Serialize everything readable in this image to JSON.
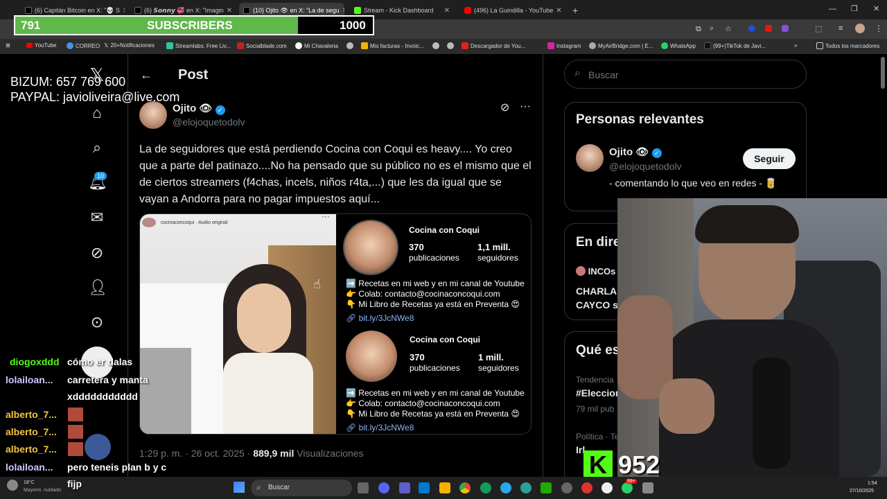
{
  "browser": {
    "tabs": [
      {
        "label": "(6) Capitán Bitcoin en X: \"💀 S",
        "color": "#000"
      },
      {
        "label": "(6) 𝙎𝙤𝙣𝙣𝙮 💞 en X: \"Imagin",
        "color": "#000"
      },
      {
        "label": "(10) Ojito 👁 en X: \"La de segu",
        "color": "#000",
        "active": true
      },
      {
        "label": "Stream - Kick Dashboard",
        "color": "#53fc18"
      },
      {
        "label": "(496) La Guindilla - YouTube",
        "color": "#ff0000"
      }
    ],
    "new_tab": "+",
    "bookmarks": [
      "YouTube",
      "CORREO",
      "20+Notificaciones",
      "Streamlabs: Free Liv...",
      "Socialblade.com",
      "Mi Chavaleria",
      "",
      "Mis facturas - Invoic...",
      "",
      "",
      "Descargador de You...",
      "Instagram",
      "MyAirBridge.com | E...",
      "WhatsApp",
      "(99+)TikTok de Javi..."
    ],
    "bookmarks_folder": "Todos los marcadores"
  },
  "overlay": {
    "subs_current": "791",
    "subs_label": "SUBSCRIBERS",
    "subs_goal": "1000",
    "subs_progress": 0.791,
    "bizum": "BIZUM: 657 769 600",
    "paypal": "PAYPAL: javioliveira@live.com",
    "kick_count": "952"
  },
  "sidebar": {
    "notifications_badge": "10"
  },
  "post": {
    "header": "Post",
    "author_name": "Ojito",
    "author_emoji": "👁",
    "author_handle": "@elojoquetodolv",
    "text": "La de seguidores que está perdiendo Cocina con Coqui es heavy.... Yo creo que a parte del patinazo....No ha pensado que su público no es el mismo que el de ciertos streamers (f4chas, incels, niños r4ta,...) que les da igual que se vayan a Andorra para no pagar impuestos aquí...",
    "video_user": "cocinaconcoqui · Audio original",
    "profile1": {
      "name": "Cocina con Coqui",
      "posts": "370",
      "posts_label": "publicaciones",
      "followers": "1,1 mill.",
      "followers_label": "seguidores"
    },
    "profile2": {
      "name": "Cocina con Coqui",
      "posts": "370",
      "posts_label": "publicaciones",
      "followers": "1 mill.",
      "followers_label": "seguidores"
    },
    "bio_line1": "➡️ Recetas en mi web y en mi canal de Youtube",
    "bio_line2": "👉 Colab: contacto@cocinaconcoqui.com",
    "bio_line3": "👇 Mi Libro de Recetas ya está en Preventa 😍",
    "bio_link": "bit.ly/3JcNWe8",
    "time": "1:29 p. m.",
    "date": "26 oct. 2025",
    "views": "889,9 mil",
    "views_label": "Visualizaciones"
  },
  "right": {
    "search_placeholder": "Buscar",
    "relevant_title": "Personas relevantes",
    "relevant_name": "Ojito",
    "relevant_handle": "@elojoquetodolv",
    "relevant_bio": "- comentando lo que veo en redes - 🥫",
    "follow_label": "Seguir",
    "live_title": "En dire",
    "live_item": "INCOs",
    "live_line1": "CHARLA",
    "live_line2": "CAYCO s",
    "trends_title": "Qué es",
    "trend1_cat": "Tendencia",
    "trend1_name": "#Eleccion",
    "trend1_posts": "79 mil pub",
    "trend2_cat": "Política · Te",
    "trend2_name": "Irl"
  },
  "chat": [
    {
      "user": "diogoxddd",
      "color": "#53fc18",
      "msg": "cómo er dalas"
    },
    {
      "user": "lolailoan...",
      "color": "#b8b8ff",
      "msg": "carretera y manta"
    },
    {
      "user": "",
      "color": "#fff",
      "msg": "xddddddddddd"
    },
    {
      "user": "alberto_7...",
      "color": "#f5c542",
      "msg": ""
    },
    {
      "user": "alberto_7...",
      "color": "#f5c542",
      "msg": ""
    },
    {
      "user": "alberto_7...",
      "color": "#f5c542",
      "msg": ""
    },
    {
      "user": "lolailoan...",
      "color": "#b8b8ff",
      "msg": "pero teneis plan b y c"
    },
    {
      "user": "",
      "color": "#fff",
      "msg": "fijp"
    }
  ],
  "taskbar": {
    "weather_temp": "18°C",
    "weather_desc": "Mayorm. nublado",
    "search": "Buscar",
    "time": "1:54",
    "date": "27/10/2025",
    "wa_badge": "99+"
  }
}
